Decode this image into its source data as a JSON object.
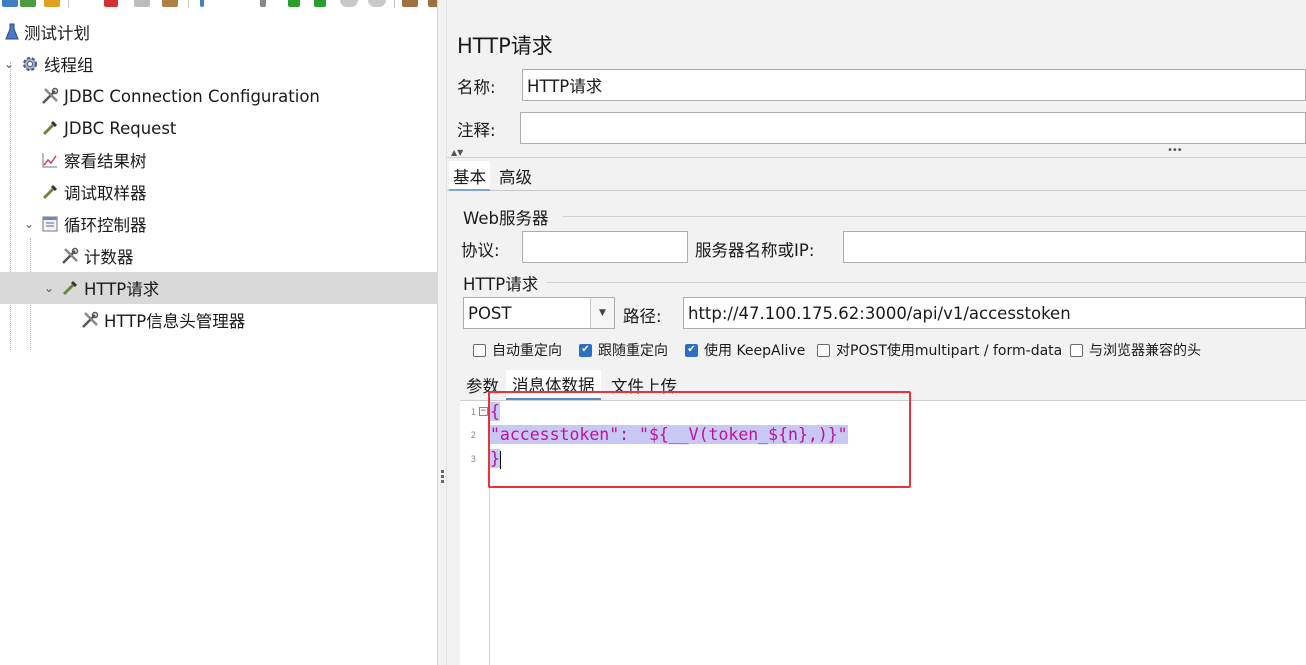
{
  "toolbar": {
    "icons": [
      "new-icon",
      "templates-icon",
      "open-icon",
      "cut-icon",
      "copy-icon",
      "paste-icon",
      "expand-icon",
      "toggle-icon",
      "start-icon",
      "start-no-pause-icon",
      "stop-icon",
      "shutdown-icon",
      "clear-icon",
      "clear-all-icon",
      "search-icon",
      "reset-search-icon",
      "function-helper-icon",
      "help-icon"
    ]
  },
  "tree": {
    "items": [
      {
        "label": "测试计划",
        "icon": "test-plan-icon"
      },
      {
        "label": "线程组",
        "icon": "thread-group-gear-icon"
      },
      {
        "label": "JDBC Connection Configuration",
        "icon": "config-tools-icon"
      },
      {
        "label": "JDBC Request",
        "icon": "sampler-pipette-icon"
      },
      {
        "label": "察看结果树",
        "icon": "listener-graph-icon"
      },
      {
        "label": "调试取样器",
        "icon": "sampler-pipette-icon"
      },
      {
        "label": "循环控制器",
        "icon": "controller-icon"
      },
      {
        "label": "计数器",
        "icon": "config-tools-icon"
      },
      {
        "label": "HTTP请求",
        "icon": "sampler-pipette-icon"
      },
      {
        "label": "HTTP信息头管理器",
        "icon": "config-tools-icon"
      }
    ]
  },
  "panel": {
    "title": "HTTP请求",
    "name_label": "名称:",
    "name_value": "HTTP请求",
    "comment_label": "注释:",
    "comment_value": "",
    "tabs": [
      "基本",
      "高级"
    ],
    "web_server": {
      "group_label": "Web服务器",
      "protocol_label": "协议:",
      "protocol_value": "",
      "server_label": "服务器名称或IP:",
      "server_value": ""
    },
    "http_request": {
      "group_label": "HTTP请求",
      "method": "POST",
      "path_label": "路径:",
      "path_value": "http://47.100.175.62:3000/api/v1/accesstoken"
    },
    "options": [
      {
        "label": "自动重定向",
        "checked": false
      },
      {
        "label": "跟随重定向",
        "checked": true
      },
      {
        "label": "使用 KeepAlive",
        "checked": true
      },
      {
        "label": "对POST使用multipart / form-data",
        "checked": false
      },
      {
        "label": "与浏览器兼容的头",
        "checked": false
      }
    ],
    "body_tabs": [
      "参数",
      "消息体数据",
      "文件上传"
    ],
    "body": {
      "lines": [
        {
          "num": "1",
          "text": "{"
        },
        {
          "num": "2",
          "text": "\"accesstoken\": \"${__V(token_${n},)}\""
        },
        {
          "num": "3",
          "text": "}"
        }
      ]
    }
  },
  "colors": {
    "selection": "#c8c8f4",
    "code_text": "#c010a0",
    "highlight_box": "#e8333a",
    "checkbox_on": "#2d6fc4"
  }
}
